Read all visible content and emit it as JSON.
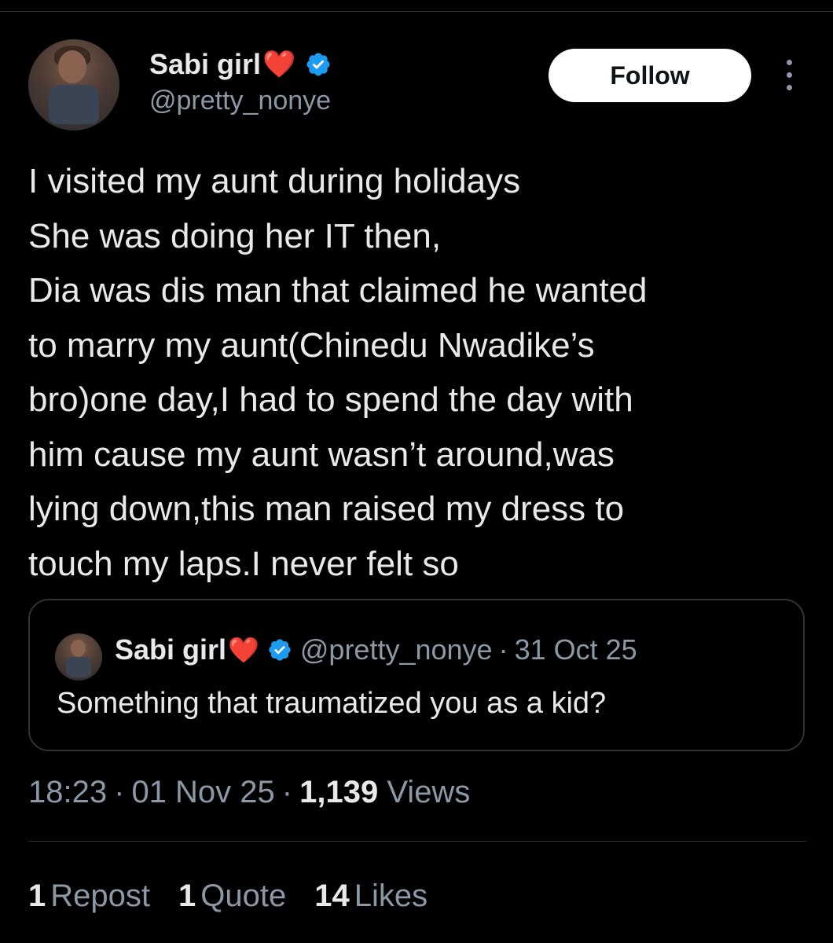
{
  "tweet": {
    "author": {
      "display_name": "Sabi girl",
      "emoji": "❤️",
      "handle": "@pretty_nonye",
      "verified": true
    },
    "follow_label": "Follow",
    "text_lines": [
      "I visited my aunt during holidays",
      "She was doing her IT then,",
      "Dia was dis man that claimed he wanted",
      "to marry my aunt(Chinedu Nwadike’s",
      "bro)one day,I had to spend the day with",
      "him cause my aunt wasn’t around,was",
      "lying down,this man raised my dress to",
      "touch my laps.I never felt so"
    ],
    "time": "18:23",
    "date": "01 Nov 25",
    "views_count": "1,139",
    "views_label": "Views",
    "separator": "·"
  },
  "quoted_tweet": {
    "display_name": "Sabi girl",
    "emoji": "❤️",
    "handle": "@pretty_nonye",
    "separator": "·",
    "date": "31 Oct 25",
    "text": "Something that traumatized you as a kid?"
  },
  "stats": {
    "reposts": {
      "count": "1",
      "label": "Repost"
    },
    "quotes": {
      "count": "1",
      "label": "Quote"
    },
    "likes": {
      "count": "14",
      "label": "Likes"
    }
  },
  "colors": {
    "background": "#000000",
    "text": "#e7e9ea",
    "secondary_text": "#8b98a5",
    "verified_blue": "#1d9bf0",
    "heart_red": "#e0202e",
    "border": "#2f3336"
  },
  "icons": {
    "verified": "verified-badge-icon",
    "more": "more-options-icon",
    "heart": "red-heart-emoji"
  }
}
